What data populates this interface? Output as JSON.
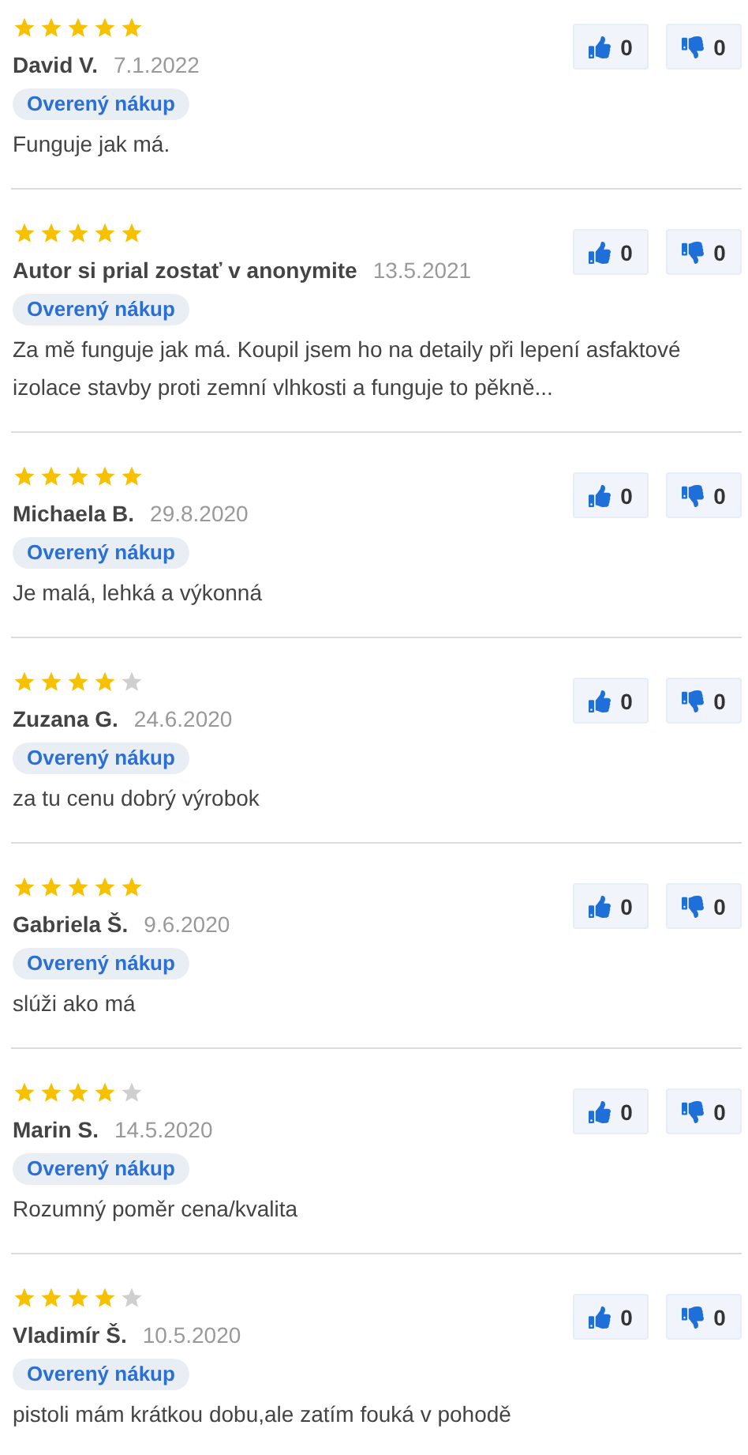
{
  "reviews": [
    {
      "stars": 5,
      "author": "David V.",
      "date": "7.1.2022",
      "badge": "Overený nákup",
      "text": "Funguje jak má.",
      "likes": "0",
      "dislikes": "0"
    },
    {
      "stars": 5,
      "author": "Autor si prial zostať v anonymite",
      "date": "13.5.2021",
      "badge": "Overený nákup",
      "text": "Za mě funguje jak má. Koupil jsem ho na detaily při lepení asfaktové izolace stavby proti zemní vlhkosti a funguje to pěkně...",
      "likes": "0",
      "dislikes": "0"
    },
    {
      "stars": 5,
      "author": "Michaela B.",
      "date": "29.8.2020",
      "badge": "Overený nákup",
      "text": "Je malá, lehká a výkonná",
      "likes": "0",
      "dislikes": "0"
    },
    {
      "stars": 4,
      "author": "Zuzana G.",
      "date": "24.6.2020",
      "badge": "Overený nákup",
      "text": "za tu cenu dobrý výrobok",
      "likes": "0",
      "dislikes": "0"
    },
    {
      "stars": 5,
      "author": "Gabriela Š.",
      "date": "9.6.2020",
      "badge": "Overený nákup",
      "text": "slúži ako má",
      "likes": "0",
      "dislikes": "0"
    },
    {
      "stars": 4,
      "author": "Marin S.",
      "date": "14.5.2020",
      "badge": "Overený nákup",
      "text": "Rozumný poměr cena/kvalita",
      "likes": "0",
      "dislikes": "0"
    },
    {
      "stars": 4,
      "author": "Vladimír Š.",
      "date": "10.5.2020",
      "badge": "Overený nákup",
      "text": "pistoli mám krátkou dobu,ale zatím fouká v pohodě",
      "likes": "0",
      "dislikes": "0"
    }
  ]
}
